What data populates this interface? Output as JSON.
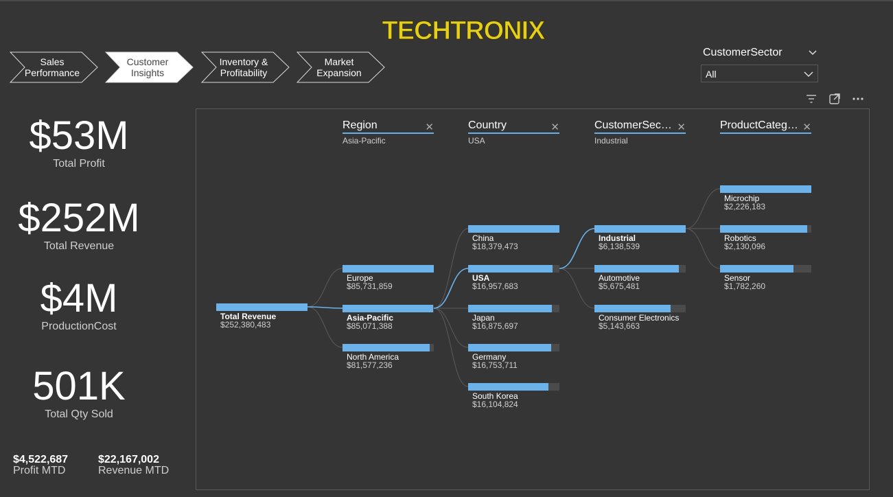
{
  "brand": {
    "logo": "TECHTRONIX"
  },
  "nav": [
    {
      "label": "Sales Performance",
      "active": false
    },
    {
      "label": "Customer Insights",
      "active": true
    },
    {
      "label": "Inventory & Profitability",
      "active": false
    },
    {
      "label": "Market Expansion",
      "active": false
    }
  ],
  "slicer": {
    "title": "CustomerSector",
    "value": "All"
  },
  "kpis": [
    {
      "value": "$53M",
      "label": "Total Profit"
    },
    {
      "value": "$252M",
      "label": "Total Revenue"
    },
    {
      "value": "$4M",
      "label": "ProductionCost"
    },
    {
      "value": "501K",
      "label": "Total Qty Sold"
    }
  ],
  "mtd": [
    {
      "value": "$4,522,687",
      "label": "Profit MTD"
    },
    {
      "value": "$22,167,002",
      "label": "Revenue MTD"
    }
  ],
  "tree": {
    "headers": [
      {
        "title": "Region",
        "selected": "Asia-Pacific"
      },
      {
        "title": "Country",
        "selected": "USA"
      },
      {
        "title": "CustomerSector",
        "selected": "Industrial"
      },
      {
        "title": "ProductCateg…",
        "selected": ""
      }
    ],
    "root": {
      "name": "Total Revenue",
      "amount": "$252,380,483",
      "fraction": 1.0
    },
    "levels": [
      [
        {
          "name": "Europe",
          "amount": "$85,731,859",
          "fraction": 1.0,
          "selected": false
        },
        {
          "name": "Asia-Pacific",
          "amount": "$85,071,388",
          "fraction": 0.992,
          "selected": true
        },
        {
          "name": "North America",
          "amount": "$81,577,236",
          "fraction": 0.952,
          "selected": false
        }
      ],
      [
        {
          "name": "China",
          "amount": "$18,379,473",
          "fraction": 1.0,
          "selected": false
        },
        {
          "name": "USA",
          "amount": "$16,957,683",
          "fraction": 0.923,
          "selected": true
        },
        {
          "name": "Japan",
          "amount": "$16,875,697",
          "fraction": 0.918,
          "selected": false
        },
        {
          "name": "Germany",
          "amount": "$16,753,711",
          "fraction": 0.912,
          "selected": false
        },
        {
          "name": "South Korea",
          "amount": "$16,104,824",
          "fraction": 0.876,
          "selected": false
        }
      ],
      [
        {
          "name": "Industrial",
          "amount": "$6,138,539",
          "fraction": 1.0,
          "selected": true
        },
        {
          "name": "Automotive",
          "amount": "$5,675,481",
          "fraction": 0.925,
          "selected": false
        },
        {
          "name": "Consumer Electronics",
          "amount": "$5,143,663",
          "fraction": 0.838,
          "selected": false
        }
      ],
      [
        {
          "name": "Microchip",
          "amount": "$2,226,183",
          "fraction": 1.0,
          "selected": false
        },
        {
          "name": "Robotics",
          "amount": "$2,130,096",
          "fraction": 0.957,
          "selected": false
        },
        {
          "name": "Sensor",
          "amount": "$1,782,260",
          "fraction": 0.801,
          "selected": false
        }
      ]
    ]
  },
  "colors": {
    "bar": "#6cb2ea",
    "bar_bg": "#4b4b4b",
    "link": "#555555",
    "link_active": "#6cb2ea",
    "background": "#353535",
    "logo": "#e8d21a"
  }
}
